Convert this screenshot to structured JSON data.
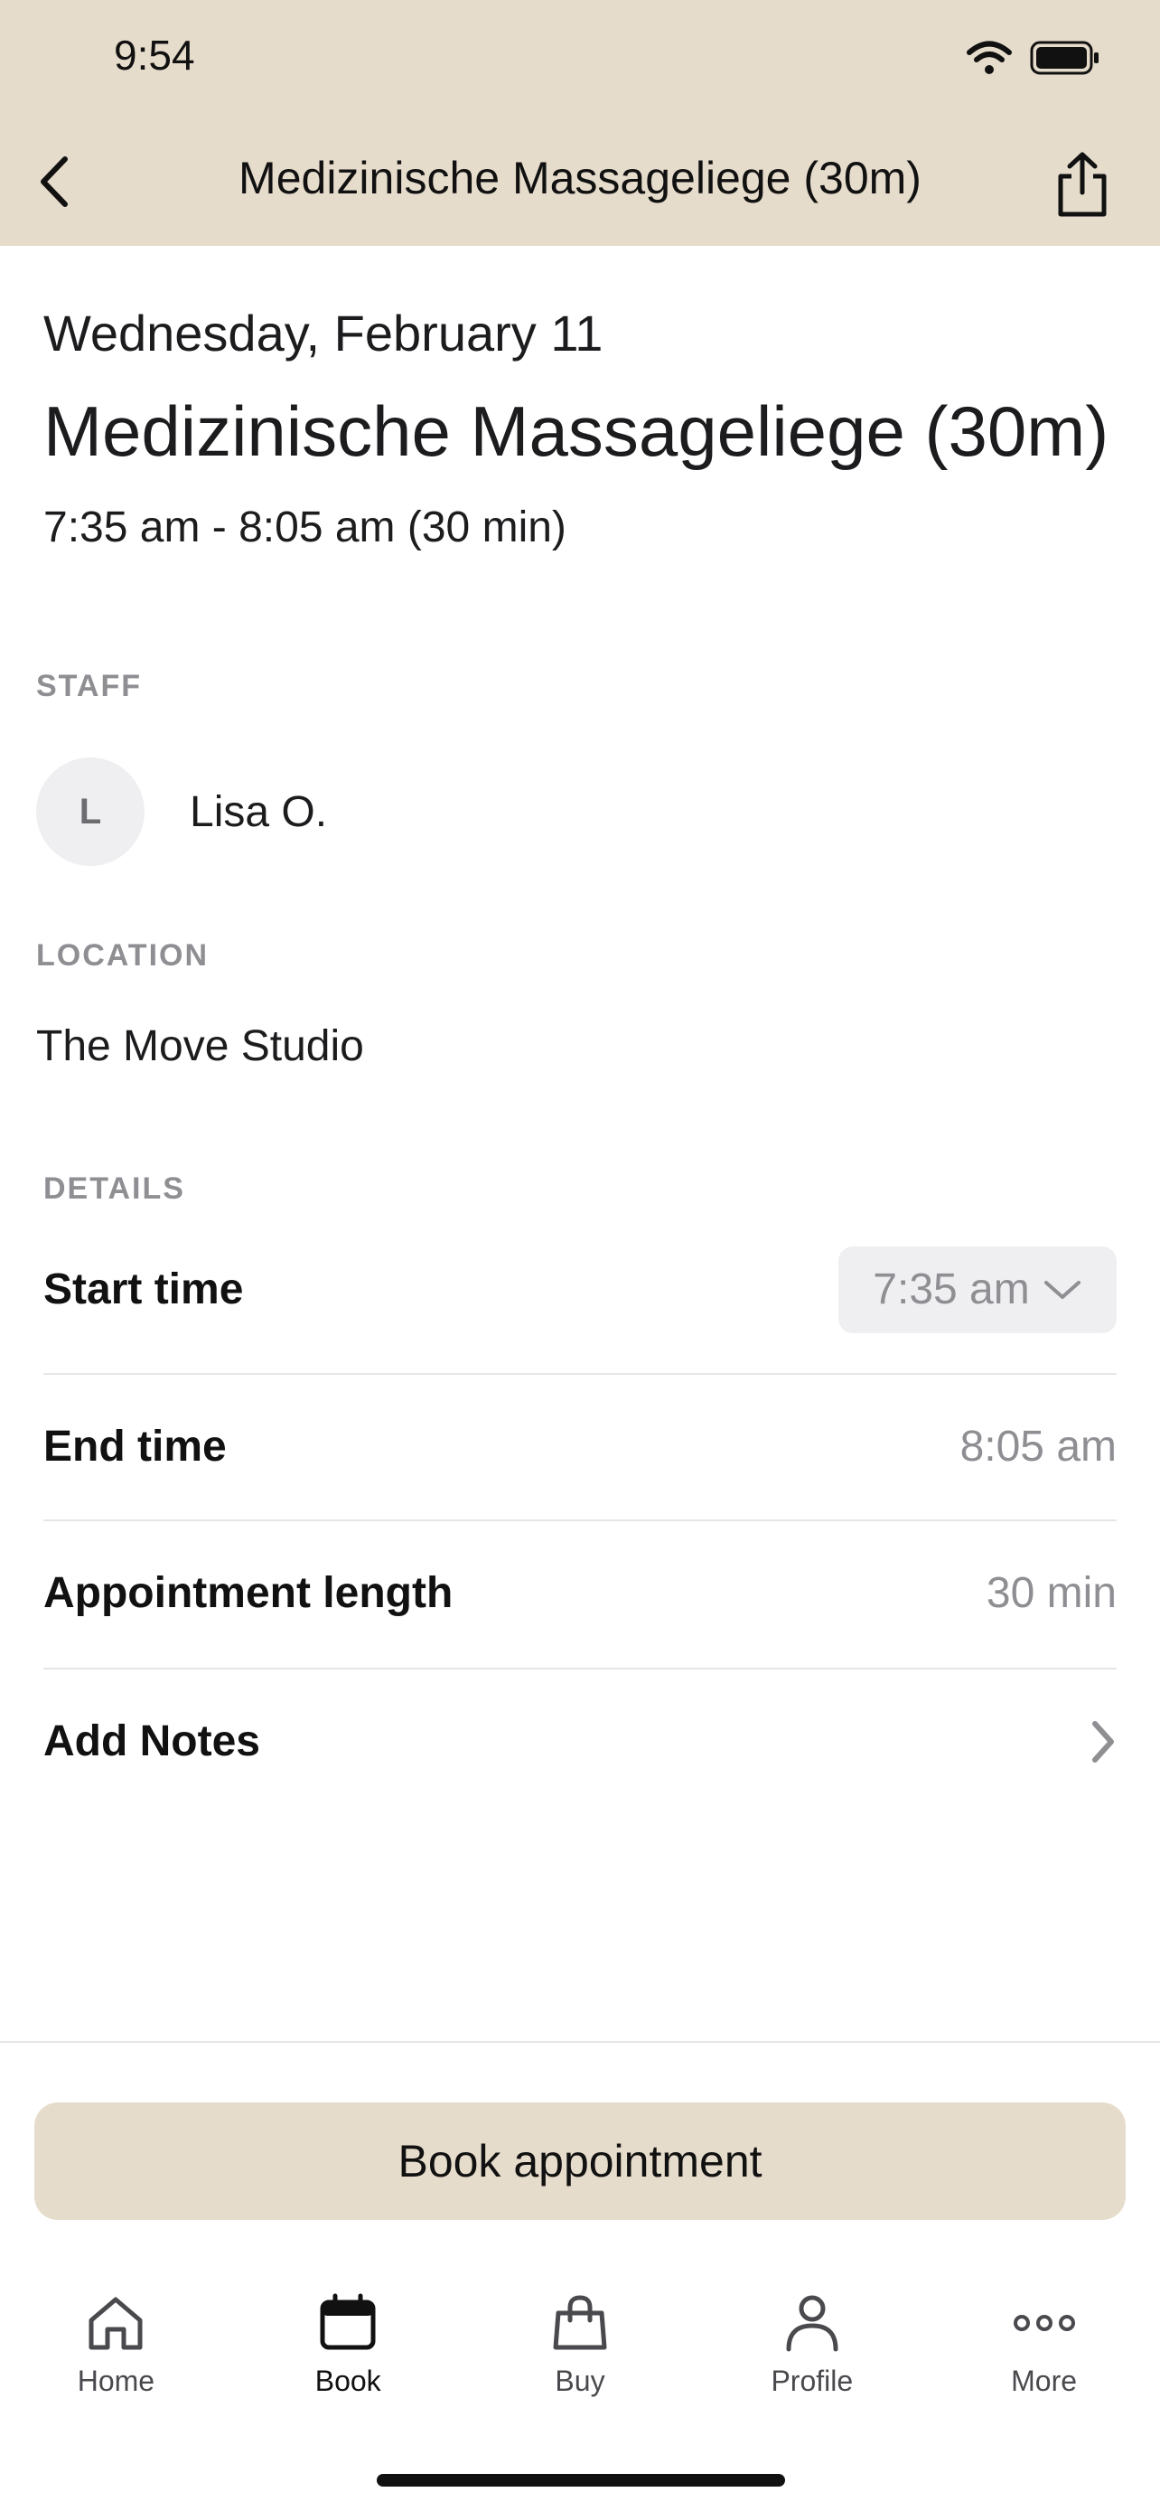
{
  "status_bar": {
    "time": "9:54"
  },
  "nav": {
    "title": "Medizinische Massageliege (30m)"
  },
  "appointment": {
    "date": "Wednesday, February 11",
    "title": "Medizinische Massageliege (30m)",
    "time_range": "7:35 am - 8:05 am (30 min)"
  },
  "staff": {
    "section_label": "STAFF",
    "initial": "L",
    "name": "Lisa O."
  },
  "location": {
    "section_label": "LOCATION",
    "name": "The Move Studio"
  },
  "details": {
    "section_label": "DETAILS",
    "start_time_label": "Start time",
    "start_time_value": "7:35 am",
    "end_time_label": "End time",
    "end_time_value": "8:05 am",
    "length_label": "Appointment length",
    "length_value": "30 min",
    "notes_label": "Add Notes"
  },
  "actions": {
    "book_label": "Book appointment"
  },
  "tabbar": {
    "items": [
      {
        "label": "Home",
        "icon": "home-icon"
      },
      {
        "label": "Book",
        "icon": "calendar-icon",
        "active": true
      },
      {
        "label": "Buy",
        "icon": "shopping-bag-icon"
      },
      {
        "label": "Profile",
        "icon": "person-icon"
      },
      {
        "label": "More",
        "icon": "more-dots-icon"
      }
    ]
  },
  "colors": {
    "header_bg": "#e6dccb",
    "button_bg": "#e6dccb",
    "muted_text": "#8e8e93"
  }
}
